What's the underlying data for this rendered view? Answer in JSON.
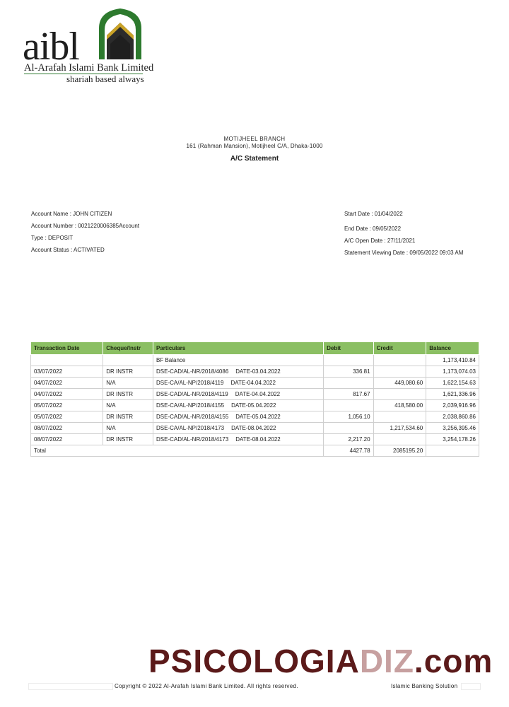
{
  "logo": {
    "wordmark": "aibl",
    "bank_name": "Al-Arafah Islami Bank Limited",
    "tagline": "shariah based always",
    "colors": {
      "green": "#2d7a2e",
      "dark": "#1e1e1e",
      "gold": "#c9a227"
    }
  },
  "header": {
    "branch": "MOTIJHEEL BRANCH",
    "address": "161 (Rahman Mansion), Motijheel C/A, Dhaka-1000",
    "title": "A/C Statement"
  },
  "account": {
    "name": "Account Name : JOHN CITIZEN",
    "number": "Account Number : 0021220006385Account",
    "type": "Type : DEPOSIT",
    "status": "Account Status : ACTIVATED",
    "start_date": "Start Date : 01/04/2022",
    "end_date": "End Date : 09/05/2022",
    "open_date": "A/C Open Date : 27/11/2021",
    "viewing_date": "Statement Viewing Date : 09/05/2022 09:03 AM"
  },
  "table": {
    "header_color": "#8bbf63",
    "headers": [
      "Transaction Date",
      "Cheque/Instr",
      "Particulars",
      "Debit",
      "Credit",
      "Balance"
    ],
    "rows": [
      {
        "date": "",
        "cheque": "",
        "particulars": "BF Balance",
        "ref_date": "",
        "debit": "",
        "credit": "",
        "balance": "1,173,410.84"
      },
      {
        "date": "03/07/2022",
        "cheque": "DR INSTR",
        "particulars": "DSE-CAD/AL-NR/2018/4086",
        "ref_date": "DATE-03.04.2022",
        "debit": "336.81",
        "credit": "",
        "balance": "1,173,074.03"
      },
      {
        "date": "04/07/2022",
        "cheque": "N/A",
        "particulars": "DSE-CA/AL-NP/2018/4119",
        "ref_date": "DATE-04.04.2022",
        "debit": "",
        "credit": "449,080.60",
        "balance": "1,622,154.63"
      },
      {
        "date": "04/07/2022",
        "cheque": "DR INSTR",
        "particulars": "DSE-CAD/AL-NR/2018/4119",
        "ref_date": "DATE-04.04.2022",
        "debit": "817.67",
        "credit": "",
        "balance": "1,621,336.96"
      },
      {
        "date": "05/07/2022",
        "cheque": "N/A",
        "particulars": "DSE-CA/AL-NP/2018/4155",
        "ref_date": "DATE-05.04.2022",
        "debit": "",
        "credit": "418,580.00",
        "balance": "2,039,916.96"
      },
      {
        "date": "05/07/2022",
        "cheque": "DR INSTR",
        "particulars": "DSE-CAD/AL-NR/2018/4155",
        "ref_date": "DATE-05.04.2022",
        "debit": "1,056.10",
        "credit": "",
        "balance": "2,038,860.86"
      },
      {
        "date": "08/07/2022",
        "cheque": "N/A",
        "particulars": "DSE-CA/AL-NP/2018/4173",
        "ref_date": "DATE-08.04.2022",
        "debit": "",
        "credit": "1,217,534.60",
        "balance": "3,256,395.46"
      },
      {
        "date": "08/07/2022",
        "cheque": "DR INSTR",
        "particulars": "DSE-CAD/AL-NR/2018/4173",
        "ref_date": "DATE-08.04.2022",
        "debit": "2,217.20",
        "credit": "",
        "balance": "3,254,178.26"
      }
    ],
    "total": {
      "label": "Total",
      "debit": "4427.78",
      "credit": "2085195.20"
    }
  },
  "watermark": {
    "main": "PSICOLOGIA",
    "dim": "DIZ",
    "suffix": ".com"
  },
  "footer": {
    "copyright": "Copyright © 2022 Al-Arafah Islami Bank Limited. All rights reserved.",
    "solution": "Islamic Banking Solution"
  }
}
